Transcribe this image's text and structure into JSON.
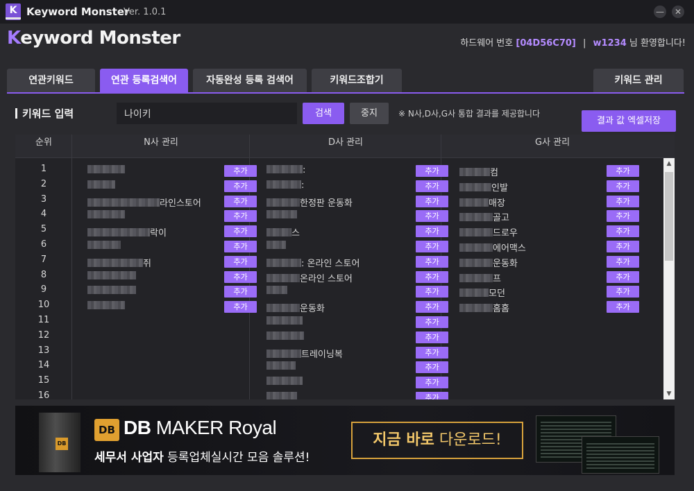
{
  "titlebar": {
    "logo": "K",
    "title": "Keyword Monster",
    "version": "Ver. 1.0.1",
    "minimize": "—",
    "close": "✕"
  },
  "header": {
    "brand_first": "K",
    "brand_rest": "eyword Monster",
    "hw_label": "하드웨어 번호",
    "hw_value": "[04D56C70]",
    "separator": "|",
    "user_id": "w1234",
    "welcome_suffix": "님 환영합니다!"
  },
  "tabs": [
    {
      "label": "연관키워드",
      "active": false
    },
    {
      "label": "연관 등록검색어",
      "active": true
    },
    {
      "label": "자동완성 등록 검색어",
      "active": false
    },
    {
      "label": "키워드조합기",
      "active": false
    },
    {
      "label": "키워드 관리",
      "active": false
    }
  ],
  "input": {
    "label": "키워드 입력",
    "value": "나이키",
    "search_btn": "검색",
    "stop_btn": "중지",
    "notice": "※ N사,D사,G사 통합 결과를 제공합니다",
    "excel_btn": "결과 값 엑셀저장"
  },
  "table": {
    "headers": {
      "rank": "순위",
      "n": "N사 관리",
      "d": "D사 관리",
      "g": "G사 관리"
    },
    "add_label": "추가",
    "ranks": [
      "1",
      "2",
      "3",
      "4",
      "5",
      "6",
      "7",
      "8",
      "9",
      "10",
      "11",
      "12",
      "13",
      "14",
      "15",
      "16"
    ],
    "n_items": [
      "",
      "",
      "라인스토어",
      "",
      "락이",
      "",
      "쥐",
      "",
      "",
      ""
    ],
    "d_items": [
      ":",
      ":",
      "한정판 운동화",
      "",
      "스",
      "",
      ": 온라인 스토어",
      "온라인 스토어",
      "",
      "운동화",
      "",
      "",
      "트레이닝복",
      "",
      "",
      ""
    ],
    "g_items": [
      "컴",
      "인발",
      "매장",
      "골고",
      "드로우",
      "에어맥스",
      "운동화",
      "프",
      "모던",
      "홈홈"
    ]
  },
  "scrollbar": {
    "up": "▲",
    "down": "▼",
    "grip": "≡"
  },
  "banner": {
    "box_logo": "DB",
    "logo": "DB",
    "title_bold": "DB",
    "title_rest": " MAKER Royal",
    "sub_bold": "세무서 사업자",
    "sub_rest": " 등록업체실시간 모음 솔루션!",
    "cta_bold": "지금 바로",
    "cta_rest": " 다운로드!"
  }
}
